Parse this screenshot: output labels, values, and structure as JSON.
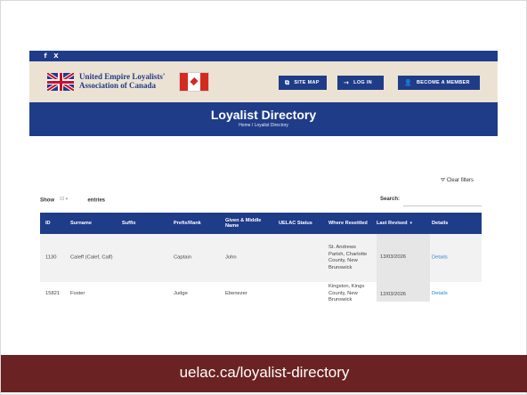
{
  "social": {
    "facebook_icon": "f",
    "x_icon": "X"
  },
  "header": {
    "logo_line1": "United Empire Loyalists'",
    "logo_line2": "Association of Canada",
    "buttons": [
      {
        "icon": "sitemap-icon",
        "glyph": "⧉",
        "label": "SITE MAP"
      },
      {
        "icon": "login-arrow-icon",
        "glyph": "→",
        "label": "LOG IN"
      },
      {
        "icon": "add-user-icon",
        "glyph": "👤",
        "label": "BECOME A MEMBER"
      }
    ]
  },
  "title_band": {
    "title": "Loyalist Directory",
    "breadcrumb": "Home / Loyalist Directory"
  },
  "controls": {
    "clear_filters": "Clear filters",
    "show_label": "Show",
    "show_value": "10",
    "entries_label": "entries",
    "search_label": "Search:"
  },
  "table": {
    "headers": {
      "id": "ID",
      "surname": "Surname",
      "suffix": "Suffix",
      "prefix": "Prefix/Rank",
      "given": "Given & Middle Name",
      "uelac": "UELAC Status",
      "where": "Where Resettled",
      "revised": "Last Revised",
      "details": "Details"
    },
    "rows": [
      {
        "id": "1130",
        "surname": "Caleff (Calef, Calf)",
        "suffix": "",
        "prefix": "Captain",
        "given": "John",
        "uelac": "",
        "where": "St. Andrews Parish, Charlotte County, New Brunswick",
        "revised": "13/03/2026",
        "details": "Details"
      },
      {
        "id": "15821",
        "surname": "Foster",
        "suffix": "",
        "prefix": "Judge",
        "given": "Ebenezer",
        "uelac": "",
        "where": "Kingston, Kings County, New Brunswick",
        "revised": "12/03/2026",
        "details": "Details"
      }
    ]
  },
  "footer": {
    "url": "uelac.ca/loyalist-directory"
  },
  "colors": {
    "navy": "#1f3c88",
    "beige": "#ece2d3",
    "maroon": "#6b2222",
    "link": "#2a7fd4"
  }
}
